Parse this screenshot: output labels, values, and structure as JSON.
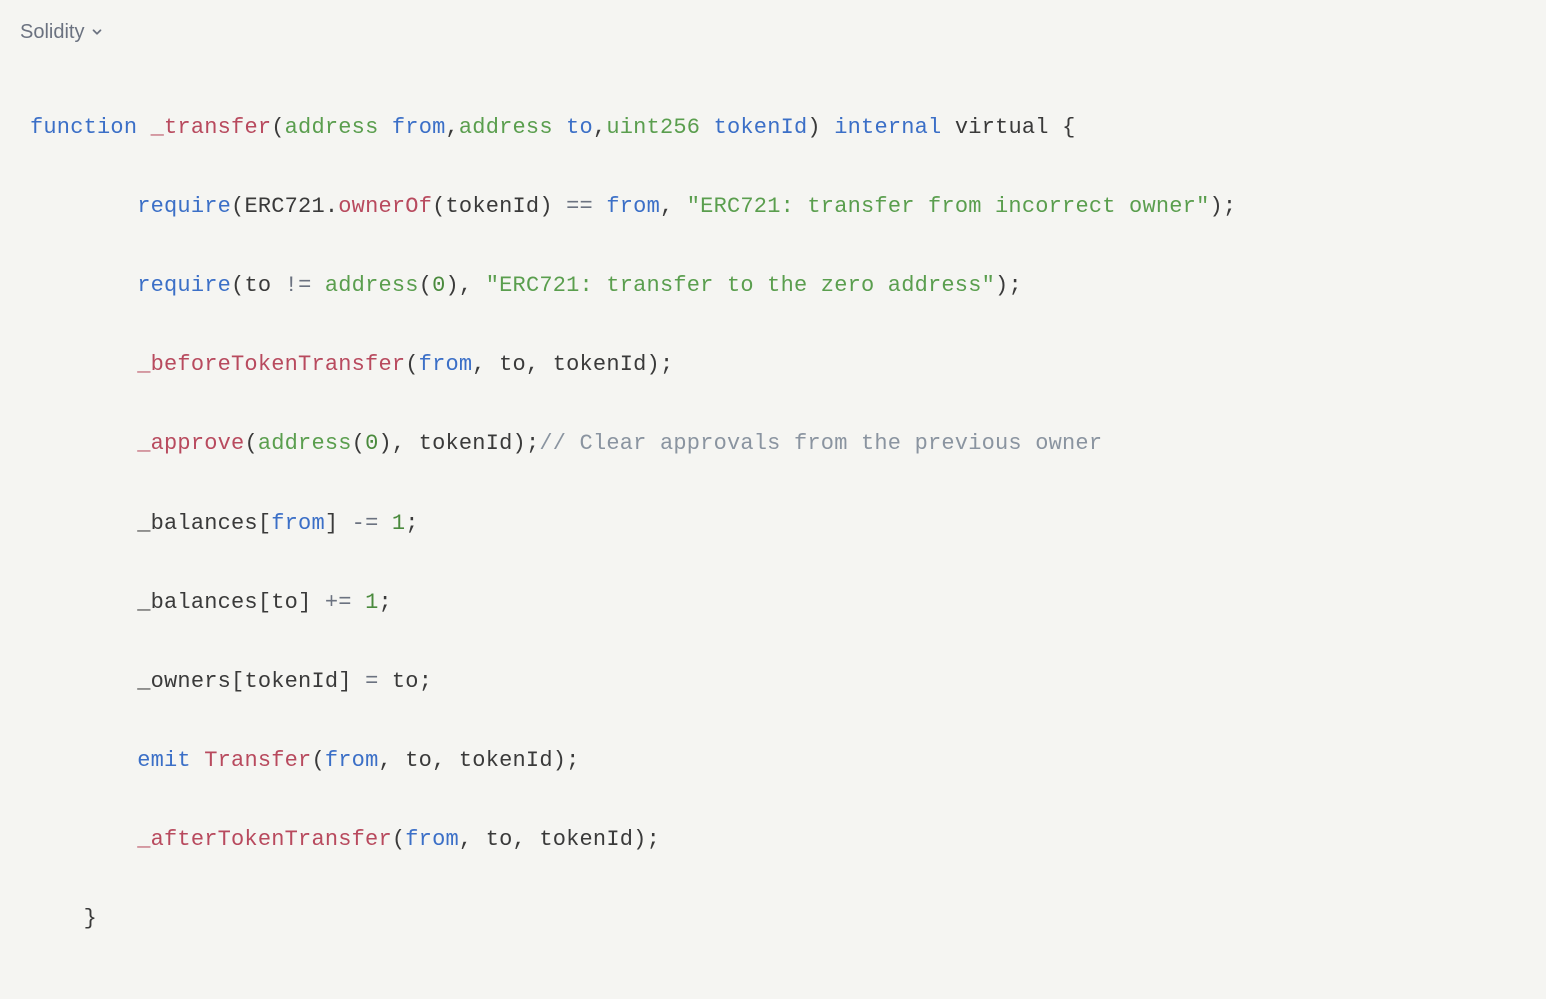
{
  "header": {
    "language_label": "Solidity"
  },
  "code": {
    "line1": {
      "kw_function": "function",
      "fn_name": "_transfer",
      "lparen": "(",
      "type1": "address",
      "param1": "from",
      "comma1": ",",
      "type2": "address",
      "param2": "to",
      "comma2": ",",
      "type3": "uint256",
      "param3": "tokenId",
      "rparen": ")",
      "kw_internal": "internal",
      "kw_virtual": "virtual",
      "lbrace": "{"
    },
    "line2": {
      "indent": "        ",
      "fn_require": "require",
      "lparen": "(",
      "class_erc": "ERC721",
      "dot": ".",
      "fn_ownerof": "ownerOf",
      "lparen2": "(",
      "arg_tokenid": "tokenId",
      "rparen2": ")",
      "op_eq": " == ",
      "arg_from": "from",
      "comma": ", ",
      "str": "\"ERC721: transfer from incorrect owner\"",
      "rparen": ")",
      "semi": ";"
    },
    "line3": {
      "indent": "        ",
      "fn_require": "require",
      "lparen": "(",
      "arg_to": "to",
      "op_ne": " != ",
      "fn_address": "address",
      "lparen2": "(",
      "zero": "0",
      "rparen2": ")",
      "comma": ", ",
      "str": "\"ERC721: transfer to the zero address\"",
      "rparen": ")",
      "semi": ";"
    },
    "line4": {
      "indent": "        ",
      "fn": "_beforeTokenTransfer",
      "lparen": "(",
      "arg_from": "from",
      "comma1": ", ",
      "arg_to": "to",
      "comma2": ", ",
      "arg_tokenid": "tokenId",
      "rparen": ")",
      "semi": ";"
    },
    "line5": {
      "indent": "        ",
      "fn": "_approve",
      "lparen": "(",
      "fn_address": "address",
      "lparen2": "(",
      "zero": "0",
      "rparen2": ")",
      "comma": ", ",
      "arg_tokenid": "tokenId",
      "rparen": ")",
      "semi": ";",
      "comment": "// Clear approvals from the previous owner"
    },
    "line6": {
      "indent": "        ",
      "ident": "_balances",
      "lbrack": "[",
      "arg_from": "from",
      "rbrack": "]",
      "op": " -= ",
      "one": "1",
      "semi": ";"
    },
    "line7": {
      "indent": "        ",
      "ident": "_balances",
      "lbrack": "[",
      "arg_to": "to",
      "rbrack": "]",
      "op": " += ",
      "one": "1",
      "semi": ";"
    },
    "line8": {
      "indent": "        ",
      "ident": "_owners",
      "lbrack": "[",
      "arg_tokenid": "tokenId",
      "rbrack": "]",
      "op": " = ",
      "arg_to": "to",
      "semi": ";"
    },
    "line9": {
      "indent": "        ",
      "kw_emit": "emit",
      "sp": " ",
      "fn_transfer": "Transfer",
      "lparen": "(",
      "arg_from": "from",
      "comma1": ", ",
      "arg_to": "to",
      "comma2": ", ",
      "arg_tokenid": "tokenId",
      "rparen": ")",
      "semi": ";"
    },
    "line10": {
      "indent": "        ",
      "fn": "_afterTokenTransfer",
      "lparen": "(",
      "arg_from": "from",
      "comma1": ", ",
      "arg_to": "to",
      "comma2": ", ",
      "arg_tokenid": "tokenId",
      "rparen": ")",
      "semi": ";"
    },
    "line11": {
      "indent": "    ",
      "rbrace": "}"
    }
  }
}
